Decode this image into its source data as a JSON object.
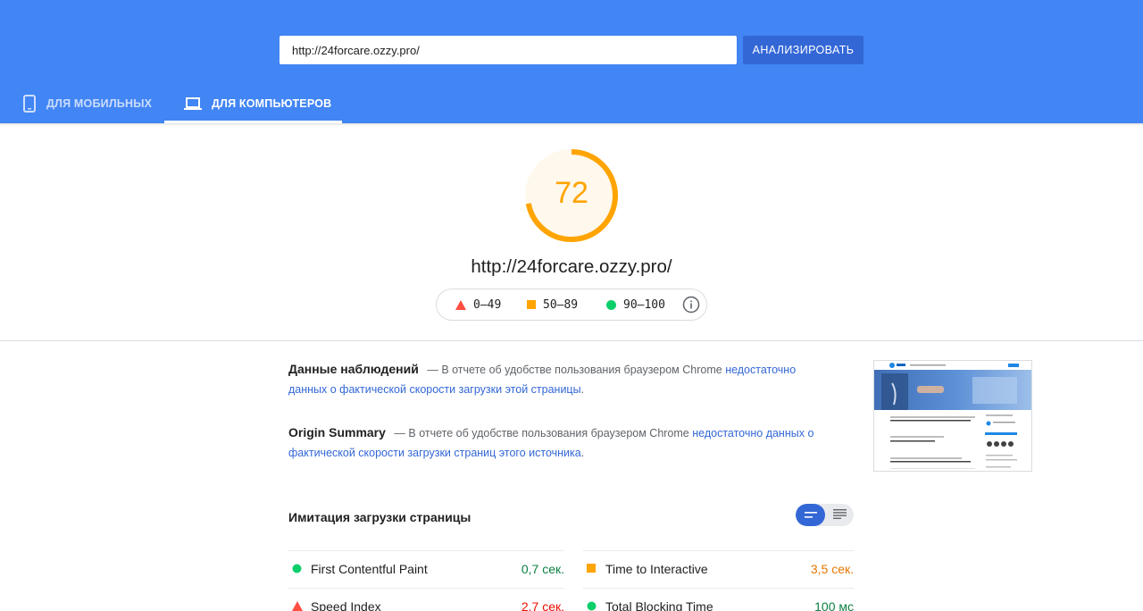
{
  "header": {
    "url_value": "http://24forcare.ozzy.pro/",
    "analyze_label": "АНАЛИЗИРОВАТЬ",
    "tabs": [
      {
        "label": "ДЛЯ МОБИЛЬНЫХ",
        "icon": "smartphone-icon",
        "active": false
      },
      {
        "label": "ДЛЯ КОМПЬЮТЕРОВ",
        "icon": "laptop-icon",
        "active": true
      }
    ]
  },
  "score": {
    "value": 72,
    "url": "http://24forcare.ozzy.pro/",
    "color": "#ffa400",
    "legend": [
      {
        "label": "0–49",
        "shape": "triangle",
        "color": "#ff4e42"
      },
      {
        "label": "50–89",
        "shape": "square",
        "color": "#ffa400"
      },
      {
        "label": "90–100",
        "shape": "circle",
        "color": "#0cce6b"
      }
    ]
  },
  "field_data": {
    "title": "Данные наблюдений",
    "text": "— В отчете об удобстве пользования браузером Chrome",
    "link": "недостаточно данных о фактической скорости загрузки этой страницы",
    "end": "."
  },
  "origin_summary": {
    "title": "Origin Summary",
    "text": "— В отчете об удобстве пользования браузером Chrome",
    "link": "недостаточно данных о фактической скорости загрузки страниц этого источника",
    "end": "."
  },
  "lab": {
    "title": "Имитация загрузки страницы",
    "metrics": [
      {
        "name": "First Contentful Paint",
        "value": "0,7 сек.",
        "status": "pass"
      },
      {
        "name": "Time to Interactive",
        "value": "3,5 сек.",
        "status": "average"
      },
      {
        "name": "Speed Index",
        "value": "2,7 сек.",
        "status": "fail"
      },
      {
        "name": "Total Blocking Time",
        "value": "100 мс",
        "status": "pass"
      }
    ]
  },
  "colors": {
    "header_bg": "#4285f4",
    "button_bg": "#3367d6",
    "link": "#3367d6",
    "pass": "#0cce6b",
    "average": "#ffa400",
    "fail": "#ff4e42"
  }
}
